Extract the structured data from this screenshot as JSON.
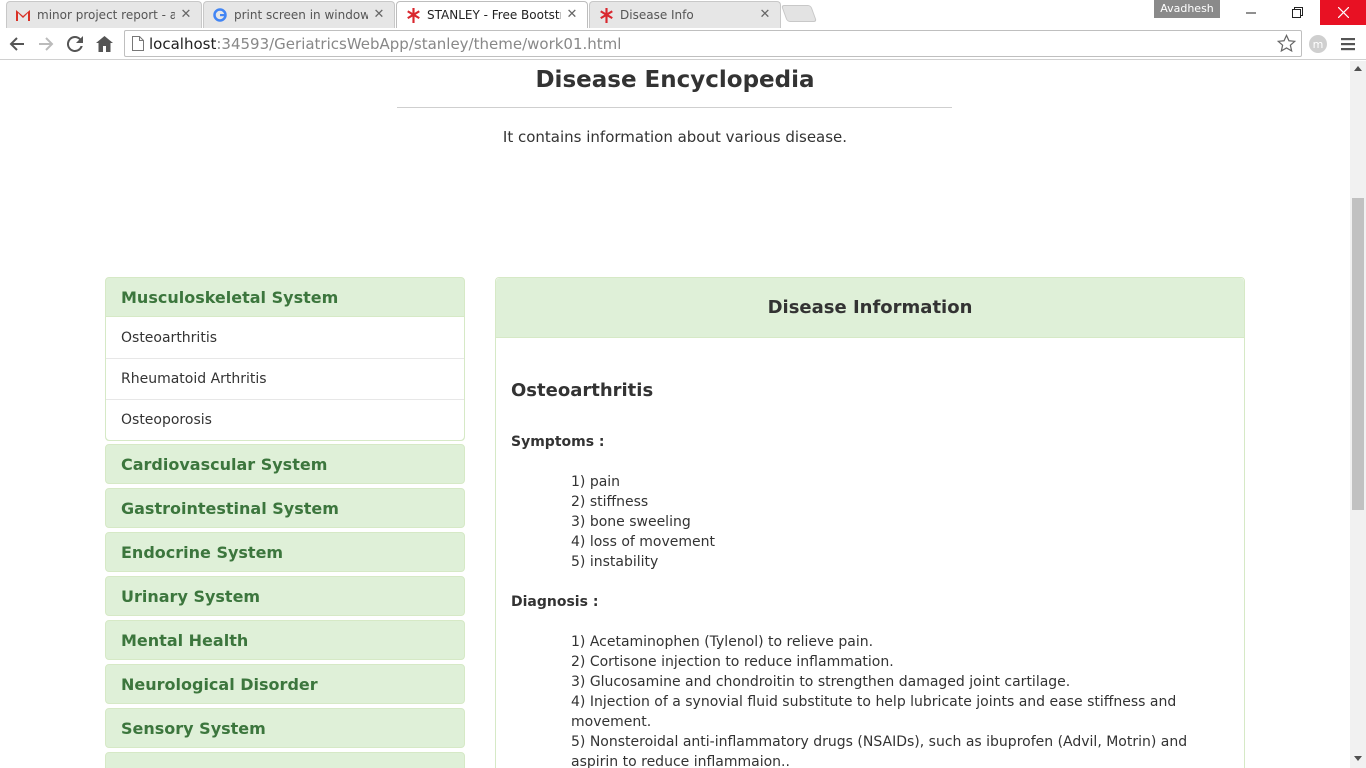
{
  "browser": {
    "tabs": [
      {
        "title": "minor project report - ava",
        "icon": "gmail-icon"
      },
      {
        "title": "print screen in windows 10",
        "icon": "google-icon"
      },
      {
        "title": "STANLEY - Free Bootstrap",
        "icon": "medical-icon",
        "active": true
      },
      {
        "title": "Disease Info",
        "icon": "medical-icon"
      }
    ],
    "profile_name": "Avadhesh",
    "url_host": "localhost",
    "url_path": ":34593/GeriatricsWebApp/stanley/theme/work01.html"
  },
  "page": {
    "title": "Disease Encyclopedia",
    "subtitle": "It contains information about various disease."
  },
  "categories": [
    {
      "label": "Musculoskeletal System",
      "items": [
        "Osteoarthritis",
        "Rheumatoid Arthritis",
        "Osteoporosis"
      ]
    },
    {
      "label": "Cardiovascular System"
    },
    {
      "label": "Gastrointestinal System"
    },
    {
      "label": "Endocrine System"
    },
    {
      "label": "Urinary System"
    },
    {
      "label": "Mental Health"
    },
    {
      "label": "Neurological Disorder"
    },
    {
      "label": "Sensory System"
    },
    {
      "label": ""
    }
  ],
  "info": {
    "header": "Disease Information",
    "disease": "Osteoarthritis",
    "symptoms_label": "Symptoms :",
    "symptoms": [
      "1) pain",
      "2) stiffness",
      "3) bone sweeling",
      "4) loss of movement",
      "5) instability"
    ],
    "diagnosis_label": "Diagnosis :",
    "diagnosis": [
      "1) Acetaminophen (Tylenol) to relieve pain.",
      "2) Cortisone injection to reduce inflammation.",
      "3) Glucosamine and chondroitin to strengthen damaged joint cartilage.",
      "4) Injection of a synovial fluid substitute to help lubricate joints and ease stiffness and movement.",
      "5) Nonsteroidal anti-inflammatory drugs (NSAIDs), such as ibuprofen (Advil, Motrin) and aspirin to reduce inflammaion.."
    ]
  },
  "colors": {
    "panel_bg": "#dff0d8",
    "panel_border": "#d6e9c6",
    "category_text": "#3c763d",
    "close_red": "#e81123"
  }
}
